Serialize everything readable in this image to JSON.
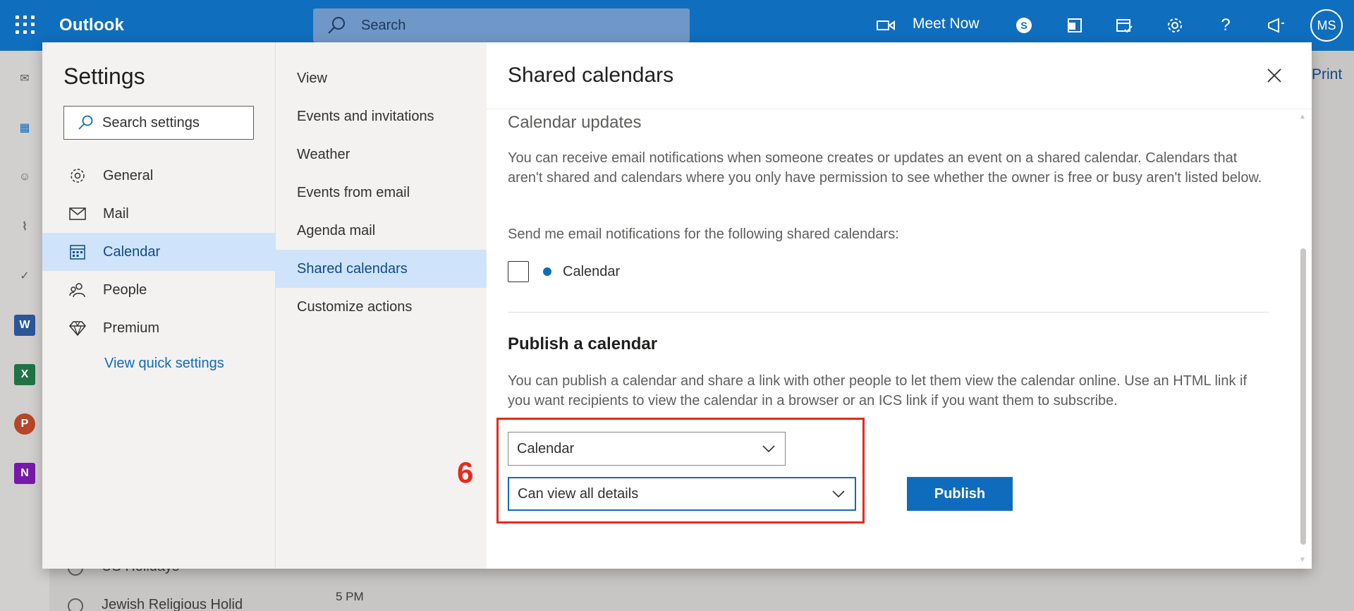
{
  "topbar": {
    "app_name": "Outlook",
    "search_placeholder": "Search",
    "meet_now": "Meet Now",
    "avatar_initials": "MS",
    "icons": [
      "app-launcher-icon",
      "video-icon",
      "skype-icon",
      "office-icon",
      "my-day-icon",
      "settings-icon",
      "help-icon",
      "feedback-icon"
    ]
  },
  "background": {
    "print_label": "Print",
    "list_items": [
      "US Holidays",
      "Jewish Religious Holid"
    ],
    "time_label": "5 PM"
  },
  "settings": {
    "title": "Settings",
    "search_placeholder": "Search settings",
    "nav": [
      {
        "label": "General",
        "icon": "gear-icon"
      },
      {
        "label": "Mail",
        "icon": "mail-icon"
      },
      {
        "label": "Calendar",
        "icon": "calendar-icon",
        "active": true
      },
      {
        "label": "People",
        "icon": "people-icon"
      },
      {
        "label": "Premium",
        "icon": "diamond-icon"
      }
    ],
    "view_quick_settings": "View quick settings"
  },
  "calendar_nav": {
    "items": [
      {
        "label": "View"
      },
      {
        "label": "Events and invitations"
      },
      {
        "label": "Weather"
      },
      {
        "label": "Events from email"
      },
      {
        "label": "Agenda mail"
      },
      {
        "label": "Shared calendars",
        "active": true
      },
      {
        "label": "Customize actions"
      }
    ]
  },
  "pane": {
    "title": "Shared calendars",
    "calendar_updates": {
      "heading": "Calendar updates",
      "description": "You can receive email notifications when someone creates or updates an event on a shared calendar. Calendars that aren't shared and calendars where you only have permission to see whether the owner is free or busy aren't listed below.",
      "prompt": "Send me email notifications for the following shared calendars:",
      "calendar_option": "Calendar",
      "checked": false
    },
    "publish": {
      "heading": "Publish a calendar",
      "description": "You can publish a calendar and share a link with other people to let them view the calendar online. Use an HTML link if you want recipients to view the calendar in a browser or an ICS link if you want them to subscribe.",
      "calendar_select": "Calendar",
      "permission_select": "Can view all details",
      "button": "Publish"
    }
  },
  "annotation": {
    "number": "6",
    "color": "#e8291c"
  },
  "colors": {
    "brand": "#106ebe",
    "accent": "#0f6cbd",
    "active_nav": "#cfe4fa"
  }
}
